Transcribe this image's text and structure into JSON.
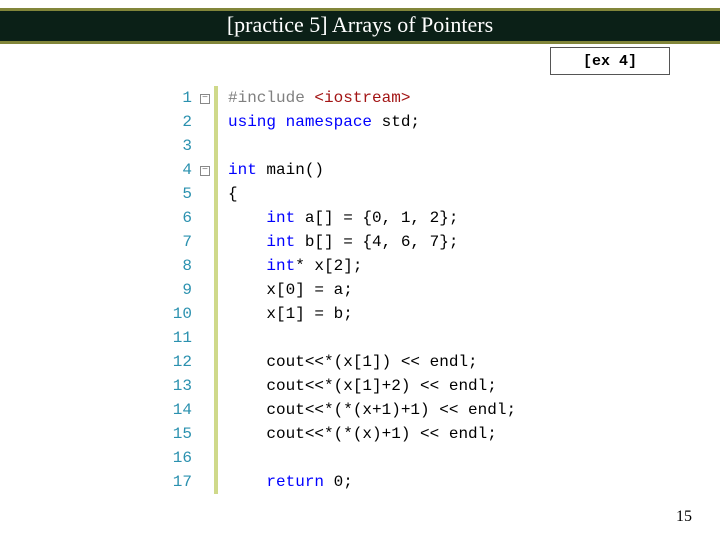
{
  "title": "[practice 5] Arrays of Pointers",
  "ex_label": "[ex 4]",
  "page_number": "15",
  "code": {
    "lines": [
      {
        "n": "1",
        "fold": true,
        "tokens": [
          {
            "c": "pp",
            "t": "#include "
          },
          {
            "c": "str",
            "t": "<iostream>"
          }
        ]
      },
      {
        "n": "2",
        "fold": false,
        "tokens": [
          {
            "c": "kw",
            "t": "using namespace "
          },
          {
            "c": "plain",
            "t": "std;"
          }
        ]
      },
      {
        "n": "3",
        "fold": false,
        "tokens": []
      },
      {
        "n": "4",
        "fold": true,
        "tokens": [
          {
            "c": "kw",
            "t": "int "
          },
          {
            "c": "plain",
            "t": "main()"
          }
        ]
      },
      {
        "n": "5",
        "fold": false,
        "tokens": [
          {
            "c": "plain",
            "t": "{"
          }
        ]
      },
      {
        "n": "6",
        "fold": false,
        "tokens": [
          {
            "c": "plain",
            "t": "    "
          },
          {
            "c": "kw",
            "t": "int "
          },
          {
            "c": "plain",
            "t": "a[] = {0, 1, 2};"
          }
        ]
      },
      {
        "n": "7",
        "fold": false,
        "tokens": [
          {
            "c": "plain",
            "t": "    "
          },
          {
            "c": "kw",
            "t": "int "
          },
          {
            "c": "plain",
            "t": "b[] = {4, 6, 7};"
          }
        ]
      },
      {
        "n": "8",
        "fold": false,
        "tokens": [
          {
            "c": "plain",
            "t": "    "
          },
          {
            "c": "kw",
            "t": "int"
          },
          {
            "c": "plain",
            "t": "* x[2];"
          }
        ]
      },
      {
        "n": "9",
        "fold": false,
        "tokens": [
          {
            "c": "plain",
            "t": "    x[0] = a;"
          }
        ]
      },
      {
        "n": "10",
        "fold": false,
        "tokens": [
          {
            "c": "plain",
            "t": "    x[1] = b;"
          }
        ]
      },
      {
        "n": "11",
        "fold": false,
        "tokens": []
      },
      {
        "n": "12",
        "fold": false,
        "tokens": [
          {
            "c": "plain",
            "t": "    cout<<*(x[1]) << endl;"
          }
        ]
      },
      {
        "n": "13",
        "fold": false,
        "tokens": [
          {
            "c": "plain",
            "t": "    cout<<*(x[1]+2) << endl;"
          }
        ]
      },
      {
        "n": "14",
        "fold": false,
        "tokens": [
          {
            "c": "plain",
            "t": "    cout<<*(*(x+1)+1) << endl;"
          }
        ]
      },
      {
        "n": "15",
        "fold": false,
        "tokens": [
          {
            "c": "plain",
            "t": "    cout<<*(*(x)+1) << endl;"
          }
        ]
      },
      {
        "n": "16",
        "fold": false,
        "tokens": []
      },
      {
        "n": "17",
        "fold": false,
        "tokens": [
          {
            "c": "plain",
            "t": "    "
          },
          {
            "c": "kw",
            "t": "return "
          },
          {
            "c": "plain",
            "t": "0;"
          }
        ]
      }
    ]
  }
}
